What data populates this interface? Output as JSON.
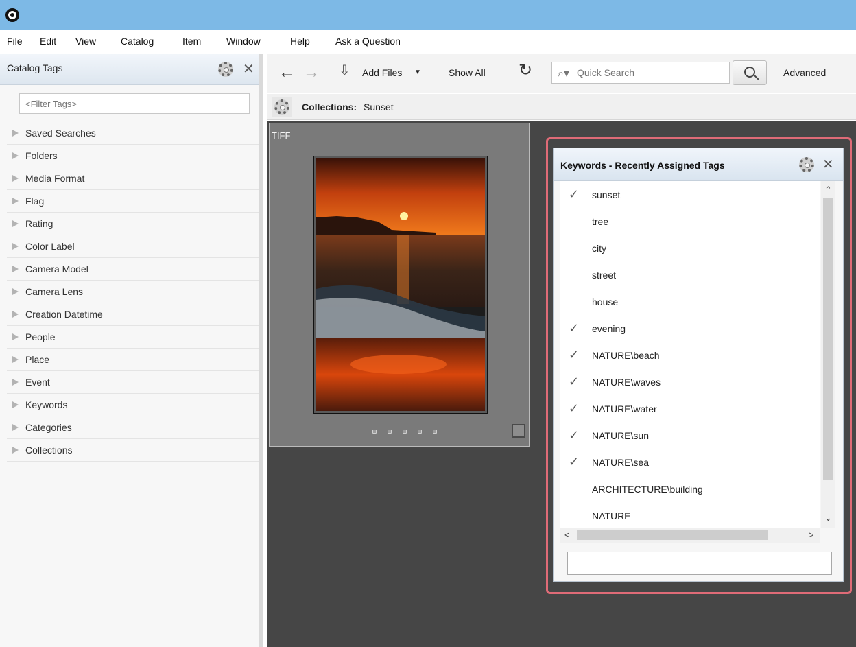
{
  "menubar": {
    "items": [
      "File",
      "Edit",
      "View",
      "Catalog",
      "Item",
      "Window",
      "Help",
      "Ask a Question"
    ]
  },
  "left_panel": {
    "title": "Catalog Tags",
    "filter_placeholder": "<Filter Tags>",
    "tags": [
      "Saved Searches",
      "Folders",
      "Media Format",
      "Flag",
      "Rating",
      "Color Label",
      "Camera Model",
      "Camera Lens",
      "Creation Datetime",
      "People",
      "Place",
      "Event",
      "Keywords",
      "Categories",
      "Collections"
    ]
  },
  "toolbar": {
    "add_files_label": "Add Files",
    "show_all_label": "Show All",
    "search_placeholder": "Quick Search",
    "advanced_label": "Advanced"
  },
  "collections_bar": {
    "label": "Collections:",
    "value": "Sunset"
  },
  "thumbnail": {
    "format_label": "TIFF"
  },
  "keywords_panel": {
    "title": "Keywords - Recently Assigned Tags",
    "items": [
      {
        "label": "sunset",
        "checked": true
      },
      {
        "label": "tree",
        "checked": false
      },
      {
        "label": "city",
        "checked": false
      },
      {
        "label": "street",
        "checked": false
      },
      {
        "label": "house",
        "checked": false
      },
      {
        "label": "evening",
        "checked": true
      },
      {
        "label": "NATURE\\beach",
        "checked": true
      },
      {
        "label": "NATURE\\waves",
        "checked": true
      },
      {
        "label": "NATURE\\water",
        "checked": true
      },
      {
        "label": "NATURE\\sun",
        "checked": true
      },
      {
        "label": "NATURE\\sea",
        "checked": true
      },
      {
        "label": "ARCHITECTURE\\building",
        "checked": false
      },
      {
        "label": "NATURE",
        "checked": false
      }
    ],
    "input_value": ""
  },
  "colors": {
    "titlebar": "#7db9e6",
    "highlight_border": "#df6b77",
    "content_background": "#464646"
  }
}
